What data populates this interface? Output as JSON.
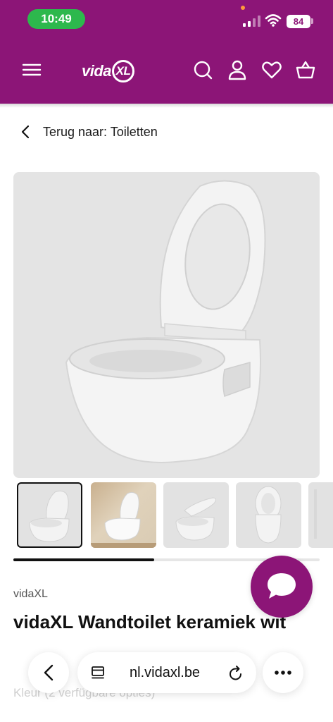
{
  "status_bar": {
    "time": "10:49",
    "battery": "84"
  },
  "header": {
    "logo_main": "vida",
    "logo_xl": "XL"
  },
  "breadcrumb": {
    "label": "Terug naar: Toiletten"
  },
  "gallery": {
    "thumbnail_count": 5,
    "selected_index": 0,
    "scroll_progress": 0.46
  },
  "product": {
    "brand": "vidaXL",
    "title": "vidaXL Wandtoilet keramiek wit"
  },
  "faded_text": "Kleur (2 verfügbare opties)",
  "browser": {
    "url": "nl.vidaxl.be"
  },
  "colors": {
    "brand_purple": "#8c1577",
    "time_green": "#2db84d"
  },
  "icons": [
    "menu-icon",
    "search-icon",
    "account-icon",
    "wishlist-icon",
    "cart-icon",
    "chevron-left-icon",
    "chat-icon",
    "reader-icon",
    "reload-icon",
    "more-icon"
  ]
}
